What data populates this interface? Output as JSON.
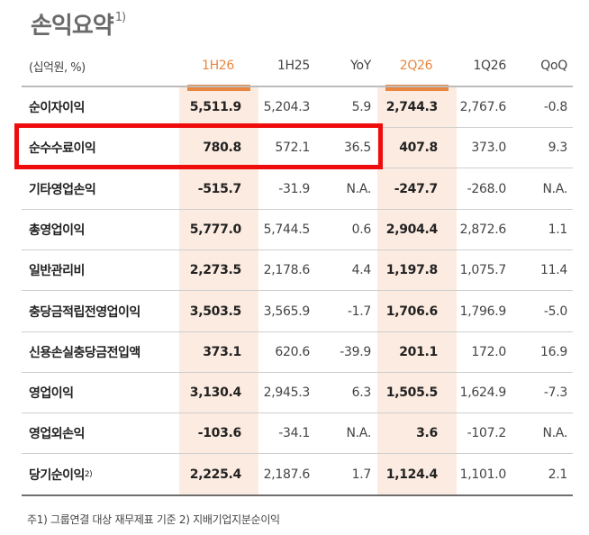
{
  "title": "손익요약",
  "title_note": "1)",
  "columns": [
    "(십억원, %)",
    "1H26",
    "1H25",
    "YoY",
    "2Q26",
    "1Q26",
    "QoQ"
  ],
  "rows": [
    {
      "label": "순이자이익",
      "note": "",
      "v": [
        "5,511.9",
        "5,204.3",
        "5.9",
        "2,744.3",
        "2,767.6",
        "-0.8"
      ]
    },
    {
      "label": "순수수료이익",
      "note": "",
      "v": [
        "780.8",
        "572.1",
        "36.5",
        "407.8",
        "373.0",
        "9.3"
      ]
    },
    {
      "label": "기타영업손익",
      "note": "",
      "v": [
        "-515.7",
        "-31.9",
        "N.A.",
        "-247.7",
        "-268.0",
        "N.A."
      ]
    },
    {
      "label": "총영업이익",
      "note": "",
      "v": [
        "5,777.0",
        "5,744.5",
        "0.6",
        "2,904.4",
        "2,872.6",
        "1.1"
      ]
    },
    {
      "label": "일반관리비",
      "note": "",
      "v": [
        "2,273.5",
        "2,178.6",
        "4.4",
        "1,197.8",
        "1,075.7",
        "11.4"
      ]
    },
    {
      "label": "충당금적립전영업이익",
      "note": "",
      "v": [
        "3,503.5",
        "3,565.9",
        "-1.7",
        "1,706.6",
        "1,796.9",
        "-5.0"
      ]
    },
    {
      "label": "신용손실충당금전입액",
      "note": "",
      "v": [
        "373.1",
        "620.6",
        "-39.9",
        "201.1",
        "172.0",
        "16.9"
      ]
    },
    {
      "label": "영업이익",
      "note": "",
      "v": [
        "3,130.4",
        "2,945.3",
        "6.3",
        "1,505.5",
        "1,624.9",
        "-7.3"
      ]
    },
    {
      "label": "영업외손익",
      "note": "",
      "v": [
        "-103.6",
        "-34.1",
        "N.A.",
        "3.6",
        "-107.2",
        "N.A."
      ]
    },
    {
      "label": "당기순이익",
      "note": "2)",
      "v": [
        "2,225.4",
        "2,187.6",
        "1.7",
        "1,124.4",
        "1,101.0",
        "2.1"
      ]
    }
  ],
  "footnote": "주1) 그룹연결 대상 재무제표 기준   2) 지배기업지분순이익",
  "colors": {
    "accent": "#e9863f",
    "highlight": "#fcebe0",
    "box": "#ee0c0c"
  }
}
